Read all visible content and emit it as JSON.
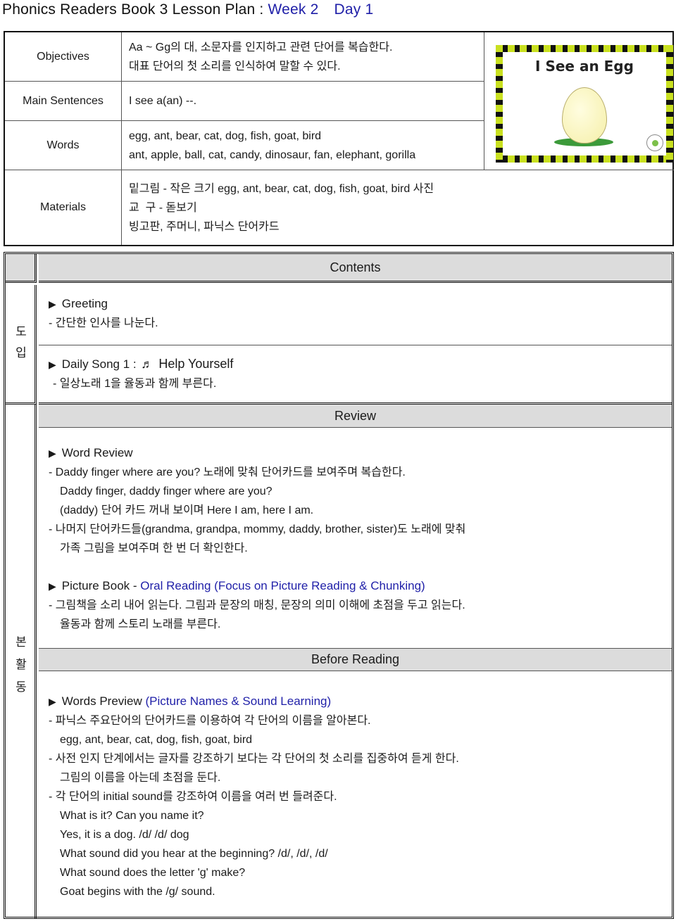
{
  "title": {
    "main": "Phonics Readers Book 3 Lesson Plan : ",
    "week": "Week 2",
    "day": "Day 1"
  },
  "info": {
    "objectives": {
      "label": "Objectives",
      "lines": [
        "Aa ~ Gg의 대, 소문자를 인지하고 관련 단어를 복습한다.",
        "대표 단어의 첫 소리를 인식하여 말할 수 있다."
      ]
    },
    "main_sentences": {
      "label": "Main Sentences",
      "value": "I see a(an) --."
    },
    "words": {
      "label": "Words",
      "lines": [
        "egg, ant, bear, cat, dog, fish, goat, bird",
        "ant, apple, ball, cat, candy, dinosaur, fan, elephant, gorilla"
      ]
    },
    "materials": {
      "label": "Materials",
      "lines": [
        "밑그림 - 작은 크기 egg, ant, bear, cat, dog, fish, goat, bird 사진",
        "교  구 - 돋보기",
        "빙고판, 주머니, 파닉스 단어카드"
      ]
    },
    "book_cover": {
      "title": "I See an Egg",
      "illustration": "egg-on-grass"
    }
  },
  "contents": {
    "header": "Contents",
    "intro": {
      "side_label": [
        "도",
        "입"
      ],
      "greeting": {
        "heading": "Greeting",
        "lines": [
          "- 간단한 인사를 나눈다."
        ]
      },
      "song": {
        "heading_prefix": "Daily Song 1 : ",
        "icon": "music-note-icon",
        "glyph": "♬",
        "heading_title": "Help Yourself",
        "lines": [
          "- 일상노래 1을 율동과 함께 부른다."
        ]
      }
    },
    "main": {
      "side_label": [
        "본",
        "활",
        "동"
      ],
      "review": {
        "header": "Review",
        "word_review": {
          "heading": "Word Review",
          "lines": [
            "- Daddy finger where are you? 노래에 맞춰 단어카드를 보여주며 복습한다.",
            "Daddy finger, daddy finger where are you?",
            "(daddy) 단어 카드 꺼내 보이며 Here I am, here I am.",
            "- 나머지 단어카드들(grandma, grandpa, mommy, daddy, brother, sister)도 노래에 맞춰",
            "가족 그림을 보여주며 한 번 더 확인한다."
          ]
        },
        "picture_book": {
          "heading": "Picture Book - ",
          "heading_blue": "Oral Reading (Focus on Picture Reading & Chunking)",
          "lines": [
            "- 그림책을 소리 내어 읽는다. 그림과 문장의 매칭, 문장의 의미 이해에 초점을 두고 읽는다.",
            "율동과 함께 스토리 노래를 부른다."
          ]
        }
      },
      "before_reading": {
        "header": "Before Reading",
        "words_preview": {
          "heading": "Words Preview ",
          "heading_blue": "(Picture Names & Sound Learning)",
          "lines": [
            "- 파닉스 주요단어의 단어카드를 이용하여 각 단어의 이름을 알아본다.",
            "egg, ant, bear, cat, dog, fish, goat, bird",
            "- 사전 인지 단계에서는 글자를 강조하기 보다는 각 단어의 첫 소리를 집중하여 듣게 한다.",
            "그림의 이름을 아는데 초점을 둔다.",
            "- 각 단어의 initial sound를 강조하여 이름을 여러 번 들려준다.",
            "What is it? Can you name it?",
            "Yes, it is a dog. /d/ /d/ dog",
            "What sound did you hear at the beginning? /d/, /d/, /d/",
            "What sound does the letter 'g' make?",
            "Goat begins with the /g/ sound."
          ]
        }
      }
    }
  }
}
